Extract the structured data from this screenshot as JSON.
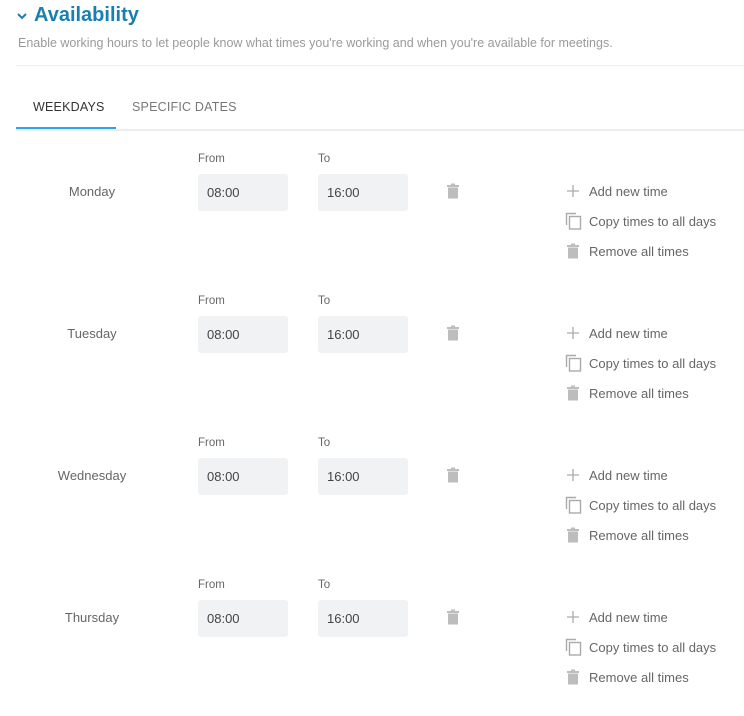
{
  "section": {
    "title": "Availability",
    "collapse_icon": "chevron-down-icon",
    "description": "Enable working hours to let people know what times you're working and when you're available for meetings."
  },
  "tabs": [
    {
      "label": "WEEKDAYS",
      "active": true
    },
    {
      "label": "SPECIFIC DATES",
      "active": false
    }
  ],
  "labels": {
    "from": "From",
    "to": "To"
  },
  "actions": {
    "add": "Add new time",
    "copy": "Copy times to all days",
    "remove": "Remove all times"
  },
  "days": [
    {
      "name": "Monday",
      "from": "08:00",
      "to": "16:00"
    },
    {
      "name": "Tuesday",
      "from": "08:00",
      "to": "16:00"
    },
    {
      "name": "Wednesday",
      "from": "08:00",
      "to": "16:00"
    },
    {
      "name": "Thursday",
      "from": "08:00",
      "to": "16:00"
    }
  ],
  "colors": {
    "accent": "#1a7fb0",
    "tab_ink": "#2aa6e8",
    "field_bg": "#f1f2f4"
  }
}
